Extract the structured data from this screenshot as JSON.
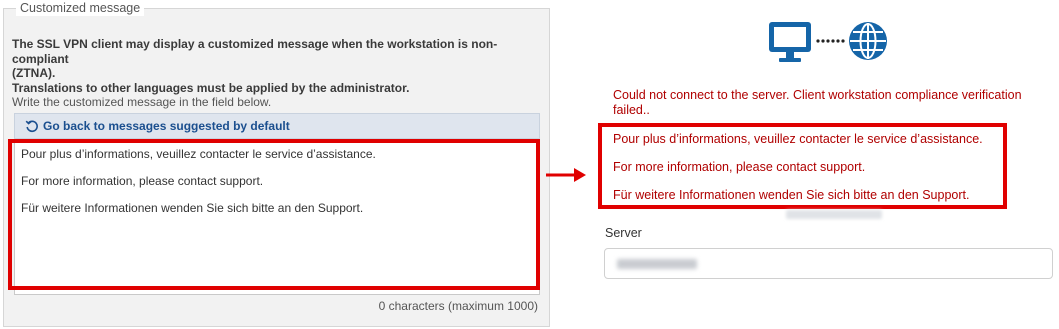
{
  "fieldset": {
    "legend": "Customized message",
    "description_line1": "The SSL VPN client may display a customized message when the workstation is non-compliant",
    "description_line2": "(ZTNA).",
    "description_line3": "Translations to other languages must be applied by the administrator.",
    "instruction": "Write the customized message in the field below.",
    "reset_label": "Go back to messages suggested by default",
    "message_lines": [
      "Pour plus d’informations, veuillez contacter le service d’assistance.",
      "For more information, please contact support.",
      "Für weitere Informationen wenden Sie sich bitte an den Support."
    ],
    "char_counter": "0 characters (maximum 1000)"
  },
  "preview": {
    "icons": [
      "computer-icon",
      "globe-icon"
    ],
    "error_line1": "Could not connect to the server. Client workstation compliance verification",
    "error_line2": "failed..",
    "message_lines": [
      "Pour plus d’informations, veuillez contacter le service d’assistance.",
      "For more information, please contact support.",
      "Für weitere Informationen wenden Sie sich bitte an den Support."
    ],
    "server_label": "Server"
  },
  "colors": {
    "highlight": "#e00000",
    "error_text": "#b00000",
    "link": "#1b4f8f",
    "icon_blue": "#1565a8"
  }
}
